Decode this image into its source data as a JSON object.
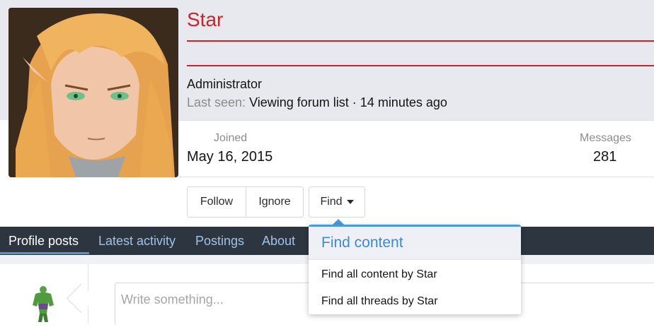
{
  "profile": {
    "username": "Star",
    "role": "Administrator",
    "last_seen_label": "Last seen:",
    "last_seen_value": "Viewing forum list · 14 minutes ago",
    "joined_label": "Joined",
    "joined_value": "May 16, 2015",
    "messages_label": "Messages",
    "messages_value": "281"
  },
  "actions": {
    "follow": "Follow",
    "ignore": "Ignore",
    "find": "Find"
  },
  "find_menu": {
    "title": "Find content",
    "items": [
      "Find all content by Star",
      "Find all threads by Star"
    ]
  },
  "tabs": [
    "Profile posts",
    "Latest activity",
    "Postings",
    "About"
  ],
  "active_tab": "Profile posts",
  "composer": {
    "placeholder": "Write something..."
  },
  "colors": {
    "username": "#c1272d",
    "nav_bg": "#2d3640",
    "tab_link": "#9fc3e7",
    "menu_accent": "#4a9ad8"
  }
}
